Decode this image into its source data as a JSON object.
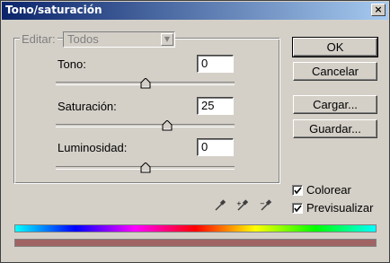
{
  "window": {
    "title": "Tono/saturación",
    "close_label": "×"
  },
  "edit": {
    "label": "Editar:",
    "value": "Todos"
  },
  "sliders": [
    {
      "name": "tono",
      "label": "Tono:",
      "value": "0",
      "min": -180,
      "max": 180,
      "level": 0
    },
    {
      "name": "saturacion",
      "label": "Saturación:",
      "value": "25",
      "min": -100,
      "max": 100,
      "level": 25
    },
    {
      "name": "luminosidad",
      "label": "Luminosidad:",
      "value": "0",
      "min": -100,
      "max": 100,
      "level": 0
    }
  ],
  "buttons": {
    "ok": "OK",
    "cancel": "Cancelar",
    "load": "Cargar...",
    "save": "Guardar..."
  },
  "options": {
    "colorize_label": "Colorear",
    "colorize_checked": true,
    "preview_label": "Previsualizar",
    "preview_checked": true
  },
  "colors": {
    "title_start": "#0a246a",
    "title_end": "#a6caf0",
    "hue_gradient": [
      "#00ffff",
      "#0000ff",
      "#ff00ff",
      "#ff0000",
      "#ffff00",
      "#00ff00",
      "#00ffff"
    ],
    "result_color": "#a06464"
  },
  "icons": [
    "eyedropper-icon",
    "eyedropper-plus-icon",
    "eyedropper-minus-icon"
  ]
}
